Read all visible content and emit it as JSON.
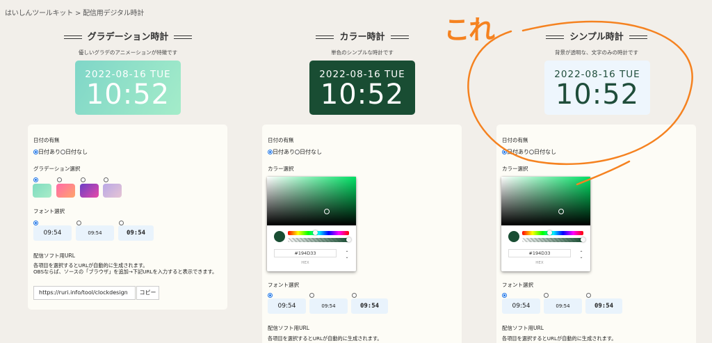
{
  "breadcrumb": "はいしんツールキット > 配信用デジタル時計",
  "annotation": "これ",
  "clock": {
    "date": "2022-08-16 TUE",
    "time": "10:52"
  },
  "columns": [
    {
      "title": "グラデーション時計",
      "desc": "優しいグラデのアニメーションが特徴です"
    },
    {
      "title": "カラー時計",
      "desc": "単色のシンプルな時計です"
    },
    {
      "title": "シンプル時計",
      "desc": "背景が透明な、文字のみの時計です"
    }
  ],
  "panel": {
    "date_label": "日付の有無",
    "date_on": "日付あり",
    "date_off": "日付なし",
    "gradient_label": "グラデーション選択",
    "color_label": "カラー選択",
    "font_label": "フォント選択",
    "font_samples": [
      "09:54",
      "09:54",
      "09:54"
    ],
    "url_label": "配信ソフト用URL",
    "url_desc_1": "各項目を選択するとURLが自動的に生成されます。",
    "url_desc_2": "OBSならば、ソースの「ブラウザ」を追加→下記URLを入力すると表示できます。",
    "url_value": "https://ruri.info/tool/clockdesign",
    "copy_label": "コピー"
  },
  "picker": {
    "hex": "#194D33",
    "hex_label": "HEX",
    "selected_color": "#194d33"
  },
  "colors": {
    "accent": "#f58220",
    "background": "#f2efea",
    "radio": "#1a73e8"
  },
  "gradients": [
    [
      "#7fdcc0",
      "#a8ecc8"
    ],
    [
      "#ff7aa0",
      "#ffa56b"
    ],
    [
      "#7a3fc6",
      "#e84aa8"
    ],
    [
      "#b9a8e6",
      "#e6c4d4"
    ]
  ]
}
